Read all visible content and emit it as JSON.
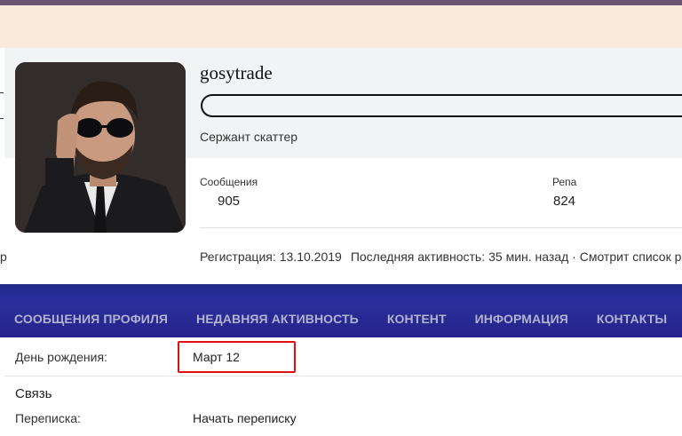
{
  "profile": {
    "username": "gosytrade",
    "rank": "Сержант скаттер",
    "stats": [
      {
        "label": "Сообщения",
        "value": "905"
      },
      {
        "label": "Репа",
        "value": "824"
      }
    ],
    "registration": {
      "label": "Регистрация:",
      "value": "13.10.2019"
    },
    "last_activity": {
      "label": "Последняя активность:",
      "value": "35 мин. назад · Смотрит список р"
    }
  },
  "edge_fragment": "р",
  "tabs": [
    {
      "label": "СООБЩЕНИЯ ПРОФИЛЯ"
    },
    {
      "label": "НЕДАВНЯЯ АКТИВНОСТЬ"
    },
    {
      "label": "КОНТЕНТ"
    },
    {
      "label": "ИНФОРМАЦИЯ"
    },
    {
      "label": "КОНТАКТЫ"
    }
  ],
  "about": {
    "birthday_label": "День рождения:",
    "birthday_value": "Март 12",
    "contact_section": "Связь",
    "conversation_label": "Переписка:",
    "conversation_value": "Начать переписку"
  },
  "colors": {
    "banner": "#2a2f9e",
    "tab_text": "#b1b3cf",
    "highlight": "#e01010",
    "header_bg": "#faeadb"
  }
}
